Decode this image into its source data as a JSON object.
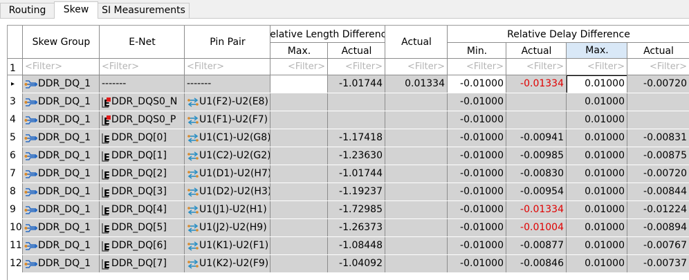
{
  "tabs": [
    {
      "label": "Routing",
      "active": false
    },
    {
      "label": "Skew",
      "active": true
    },
    {
      "label": "SI Measurements",
      "active": false
    }
  ],
  "headers": {
    "skew_group": "Skew Group",
    "e_net": "E-Net",
    "pin_pair": "Pin Pair",
    "rel_length": "Relative Length Difference",
    "rel_length_max": "Max.",
    "rel_length_actual": "Actual",
    "actual": "Actual",
    "rel_delay": "Relative Delay Difference",
    "rel_delay_min": "Min.",
    "rel_delay_actual": "Actual",
    "rel_delay_max": "Max.",
    "rel_delay_actual2": "Actual"
  },
  "filter_placeholder": "<Filter>",
  "filter_row_number": "1",
  "rows": [
    {
      "num": "",
      "marker": "▸",
      "group": "DDR_DQ_1",
      "net": "-------",
      "pins": "-------",
      "len_max": "",
      "len_actual": "-1.01744",
      "actual": "0.01334",
      "d_min": "-0.01000",
      "d_actual": "-0.01334",
      "d_actual_red": true,
      "d_max": "0.01000",
      "d_actual2": "-0.00720",
      "net_type": "none",
      "summary": true
    },
    {
      "num": "3",
      "marker": "",
      "group": "DDR_DQ_1",
      "net": "DDR_DQS0_N",
      "pins": "U1(F2)-U2(E8)",
      "len_max": "",
      "len_actual": "",
      "actual": "",
      "d_min": "-0.01000",
      "d_actual": "",
      "d_actual_red": false,
      "d_max": "0.01000",
      "d_actual2": "",
      "net_type": "diff",
      "summary": false
    },
    {
      "num": "4",
      "marker": "",
      "group": "DDR_DQ_1",
      "net": "DDR_DQS0_P",
      "pins": "U1(F1)-U2(F7)",
      "len_max": "",
      "len_actual": "",
      "actual": "",
      "d_min": "-0.01000",
      "d_actual": "",
      "d_actual_red": false,
      "d_max": "0.01000",
      "d_actual2": "",
      "net_type": "diff",
      "summary": false
    },
    {
      "num": "5",
      "marker": "",
      "group": "DDR_DQ_1",
      "net": "DDR_DQ[0]",
      "pins": "U1(C1)-U2(G8)",
      "len_max": "",
      "len_actual": "-1.17418",
      "actual": "",
      "d_min": "-0.01000",
      "d_actual": "-0.00941",
      "d_actual_red": false,
      "d_max": "0.01000",
      "d_actual2": "-0.00831",
      "net_type": "single",
      "summary": false
    },
    {
      "num": "6",
      "marker": "",
      "group": "DDR_DQ_1",
      "net": "DDR_DQ[1]",
      "pins": "U1(C2)-U2(G2)",
      "len_max": "",
      "len_actual": "-1.23630",
      "actual": "",
      "d_min": "-0.01000",
      "d_actual": "-0.00985",
      "d_actual_red": false,
      "d_max": "0.01000",
      "d_actual2": "-0.00875",
      "net_type": "single",
      "summary": false
    },
    {
      "num": "7",
      "marker": "",
      "group": "DDR_DQ_1",
      "net": "DDR_DQ[2]",
      "pins": "U1(D1)-U2(H7)",
      "len_max": "",
      "len_actual": "-1.01744",
      "actual": "",
      "d_min": "-0.01000",
      "d_actual": "-0.00830",
      "d_actual_red": false,
      "d_max": "0.01000",
      "d_actual2": "-0.00720",
      "net_type": "single",
      "summary": false
    },
    {
      "num": "8",
      "marker": "",
      "group": "DDR_DQ_1",
      "net": "DDR_DQ[3]",
      "pins": "U1(D2)-U2(H3)",
      "len_max": "",
      "len_actual": "-1.19237",
      "actual": "",
      "d_min": "-0.01000",
      "d_actual": "-0.00954",
      "d_actual_red": false,
      "d_max": "0.01000",
      "d_actual2": "-0.00844",
      "net_type": "single",
      "summary": false
    },
    {
      "num": "9",
      "marker": "",
      "group": "DDR_DQ_1",
      "net": "DDR_DQ[4]",
      "pins": "U1(J1)-U2(H1)",
      "len_max": "",
      "len_actual": "-1.72985",
      "actual": "",
      "d_min": "-0.01000",
      "d_actual": "-0.01334",
      "d_actual_red": true,
      "d_max": "0.01000",
      "d_actual2": "-0.01224",
      "net_type": "single",
      "summary": false
    },
    {
      "num": "10",
      "marker": "",
      "group": "DDR_DQ_1",
      "net": "DDR_DQ[5]",
      "pins": "U1(J2)-U2(H9)",
      "len_max": "",
      "len_actual": "-1.26373",
      "actual": "",
      "d_min": "-0.01000",
      "d_actual": "-0.01004",
      "d_actual_red": true,
      "d_max": "0.01000",
      "d_actual2": "-0.00894",
      "net_type": "single",
      "summary": false
    },
    {
      "num": "11",
      "marker": "",
      "group": "DDR_DQ_1",
      "net": "DDR_DQ[6]",
      "pins": "U1(K1)-U2(F1)",
      "len_max": "",
      "len_actual": "-1.08448",
      "actual": "",
      "d_min": "-0.01000",
      "d_actual": "-0.00877",
      "d_actual_red": false,
      "d_max": "0.01000",
      "d_actual2": "-0.00767",
      "net_type": "single",
      "summary": false
    },
    {
      "num": "12",
      "marker": "",
      "group": "DDR_DQ_1",
      "net": "DDR_DQ[7]",
      "pins": "U1(K2)-U2(F9)",
      "len_max": "",
      "len_actual": "-1.04092",
      "actual": "",
      "d_min": "-0.01000",
      "d_actual": "-0.00846",
      "d_actual_red": false,
      "d_max": "0.01000",
      "d_actual2": "-0.00737",
      "net_type": "single",
      "summary": false
    }
  ],
  "icons": {
    "skew_group": "skew-group-icon",
    "single_net": "enet-icon",
    "diff_net": "enet-diff-icon",
    "pin_pair": "pin-pair-icon",
    "current_row": "row-pointer-icon"
  },
  "colors": {
    "red_value": "#e00000",
    "row_bg": "#d3d3d3",
    "selected_header": "#d9e8f7"
  }
}
